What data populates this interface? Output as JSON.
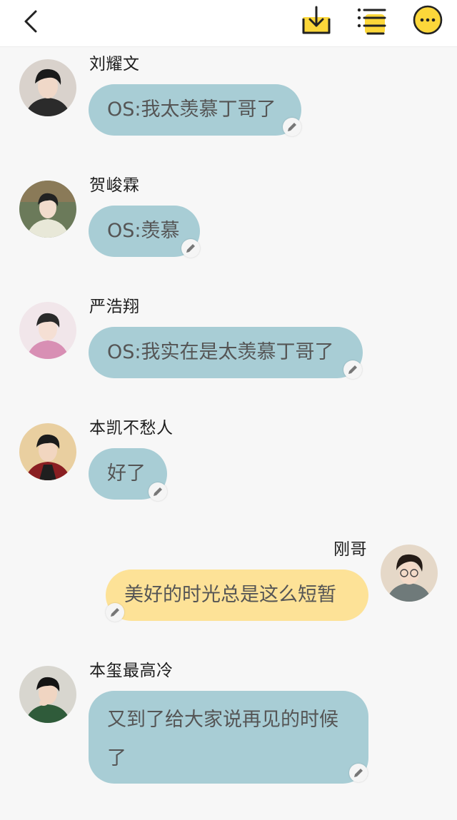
{
  "colors": {
    "accent_yellow": "#fcd73a",
    "bubble_blue": "#a8cdd5",
    "bubble_yellow": "#fde297",
    "background": "#f7f7f7"
  },
  "toolbar": {
    "back_icon": "chevron-left-icon",
    "download_icon": "download-icon",
    "list_icon": "list-icon",
    "more_icon": "more-horizontal-icon"
  },
  "messages": [
    {
      "sender": "刘耀文",
      "text": "OS:我太羡慕丁哥了",
      "side": "left"
    },
    {
      "sender": "贺峻霖",
      "text": "OS:羡慕",
      "side": "left"
    },
    {
      "sender": "严浩翔",
      "text": "OS:我实在是太羡慕丁哥了",
      "side": "left"
    },
    {
      "sender": "本凯不愁人",
      "text": "好了",
      "side": "left"
    },
    {
      "sender": "刚哥",
      "text": "美好的时光总是这么短暂",
      "side": "right"
    },
    {
      "sender": "本玺最高冷",
      "text": "又到了给大家说再见的时候了",
      "side": "left"
    }
  ]
}
